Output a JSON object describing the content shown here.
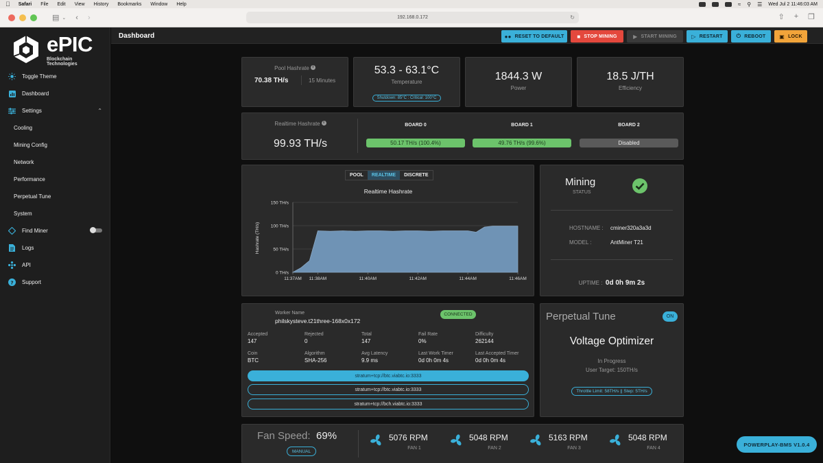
{
  "menubar": {
    "app": "Safari",
    "items": [
      "File",
      "Edit",
      "View",
      "History",
      "Bookmarks",
      "Window",
      "Help"
    ],
    "datetime": "Wed Jul 2  11:46:03 AM"
  },
  "browser": {
    "url": "192.168.0.172"
  },
  "sidebar": {
    "brand": "ePIC",
    "tagline": "Blockchain Technologies",
    "items": [
      {
        "label": "Toggle Theme",
        "icon": "sun-icon"
      },
      {
        "label": "Dashboard",
        "icon": "chart-icon"
      },
      {
        "label": "Settings",
        "icon": "sliders-icon"
      },
      {
        "label": "Cooling"
      },
      {
        "label": "Mining Config"
      },
      {
        "label": "Network"
      },
      {
        "label": "Performance"
      },
      {
        "label": "Perpetual Tune"
      },
      {
        "label": "System"
      },
      {
        "label": "Find Miner",
        "icon": "diamond-icon"
      },
      {
        "label": "Logs",
        "icon": "document-icon"
      },
      {
        "label": "API",
        "icon": "api-icon"
      },
      {
        "label": "Support",
        "icon": "help-icon"
      }
    ]
  },
  "header": {
    "title": "Dashboard",
    "buttons": {
      "reset": "RESET TO DEFAULT",
      "stop": "STOP MINING",
      "start": "START MINING",
      "restart": "RESTART",
      "reboot": "REBOOT",
      "lock": "LOCK"
    }
  },
  "pool": {
    "label": "Pool Hashrate",
    "value": "70.38 TH/s",
    "window": "15 Minutes"
  },
  "temperature": {
    "value": "53.3 - 63.1°C",
    "label": "Temperature",
    "limits": "Shutdown: 85°C : Critical: 100°C"
  },
  "power": {
    "value": "1844.3 W",
    "label": "Power"
  },
  "efficiency": {
    "value": "18.5 J/TH",
    "label": "Efficiency"
  },
  "realtime": {
    "label": "Realtime Hashrate",
    "value": "99.93 TH/s",
    "boards": [
      {
        "name": "BOARD 0",
        "status": "50.17 TH/s (100.4%)"
      },
      {
        "name": "BOARD 1",
        "status": "49.76 TH/s (99.6%)"
      },
      {
        "name": "BOARD 2",
        "status": "Disabled"
      }
    ]
  },
  "chart_tabs": [
    "POOL",
    "REALTIME",
    "DISCRETE"
  ],
  "chart_data": {
    "type": "area",
    "title": "Realtime Hashrate",
    "ylabel": "Hashrate (TH/s)",
    "xlabel": "",
    "x": [
      "11:37:00",
      "11:37:20",
      "11:37:40",
      "11:38:00",
      "11:38:30",
      "11:39:00",
      "11:39:30",
      "11:40:00",
      "11:40:30",
      "11:41:00",
      "11:41:30",
      "11:42:00",
      "11:42:30",
      "11:43:00",
      "11:43:30",
      "11:44:00",
      "11:44:20",
      "11:44:40",
      "11:45:00",
      "11:45:30",
      "11:46:00"
    ],
    "values": [
      0,
      10,
      25,
      89,
      88,
      89,
      88,
      89,
      89,
      88,
      89,
      89,
      88,
      89,
      89,
      89,
      86,
      97,
      99,
      99,
      99
    ],
    "ylim": [
      0,
      150
    ],
    "yticks": [
      "0 TH/s",
      "50 TH/s",
      "100 TH/s",
      "150 TH/s"
    ],
    "xticks": [
      "11:37AM",
      "11:38AM",
      "11:40AM",
      "11:42AM",
      "11:44AM",
      "11:46AM"
    ],
    "color": "#6f93b5"
  },
  "status": {
    "state": "Mining",
    "state_label": "STATUS",
    "hostname_label": "HOSTNAME :",
    "hostname": "cminer320a3a3d",
    "model_label": "MODEL :",
    "model": "AntMiner T21",
    "uptime_label": "UPTIME :",
    "uptime": "0d 0h 9m 2s"
  },
  "worker": {
    "name_label": "Worker Name",
    "name": "philskysteve.t21three-168x0x172",
    "connection": "CONNECTED",
    "stats": [
      {
        "label": "Accepted",
        "value": "147"
      },
      {
        "label": "Rejected",
        "value": "0"
      },
      {
        "label": "Total",
        "value": "147"
      },
      {
        "label": "Fail Rate",
        "value": "0%"
      },
      {
        "label": "Difficulty",
        "value": "262144"
      },
      {
        "label": "Coin",
        "value": "BTC"
      },
      {
        "label": "Algorithm",
        "value": "SHA-256"
      },
      {
        "label": "Avg Latency",
        "value": "9.9 ms"
      },
      {
        "label": "Last Work Timer",
        "value": "0d 0h 0m 4s"
      },
      {
        "label": "Last Accepted Timer",
        "value": "0d 0h 0m 4s"
      }
    ],
    "pools": [
      "stratum+tcp://btc.viabtc.io:3333",
      "stratum+tcp://btc.viabtc.io:3333",
      "stratum+tcp://bch.viabtc.io:3333"
    ]
  },
  "perpetual": {
    "title": "Perpetual Tune",
    "toggle": "ON",
    "mode": "Voltage Optimizer",
    "state": "In Progress",
    "target": "User Target: 150TH/s",
    "limits": "Throttle Limit: 58TH/s || Step: 5TH/s"
  },
  "fans": {
    "label": "Fan Speed:",
    "value": "69%",
    "mode": "MANUAL",
    "items": [
      {
        "rpm": "5076 RPM",
        "name": "FAN 1"
      },
      {
        "rpm": "5048 RPM",
        "name": "FAN 2"
      },
      {
        "rpm": "5163 RPM",
        "name": "FAN 3"
      },
      {
        "rpm": "5048 RPM",
        "name": "FAN 4"
      }
    ]
  },
  "version": "POWERPLAY-BMS V1.0.4",
  "colors": {
    "accent": "#3ab0d9",
    "danger": "#e4483d",
    "warning": "#f2a43a",
    "success": "#6cc36b"
  }
}
